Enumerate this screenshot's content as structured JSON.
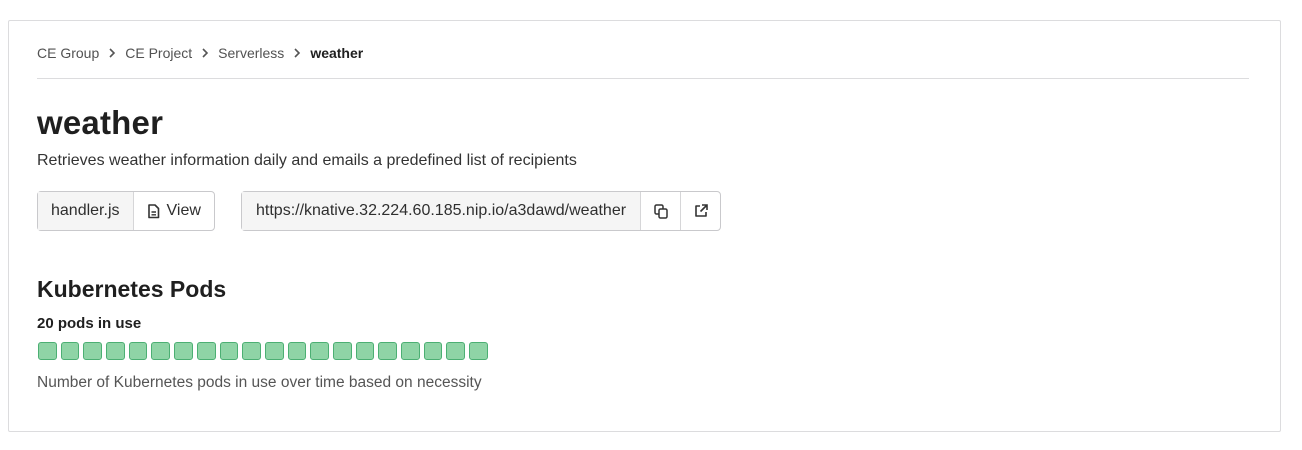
{
  "breadcrumb": {
    "items": [
      "CE Group",
      "CE Project",
      "Serverless"
    ],
    "current": "weather"
  },
  "function": {
    "title": "weather",
    "description": "Retrieves weather information daily and emails a predefined list of recipients",
    "handler_file": "handler.js",
    "view_label": "View",
    "url": "https://knative.32.224.60.185.nip.io/a3dawd/weather"
  },
  "icons": {
    "breadcrumb_separator": "chevron-right-icon",
    "view": "file-icon",
    "copy": "copy-icon",
    "open": "external-link-icon"
  },
  "pods": {
    "heading": "Kubernetes Pods",
    "count_label": "20 pods in use",
    "count": 20,
    "help_text": "Number of Kubernetes pods in use over time based on necessity",
    "pod_color": "#8fd4a6",
    "pod_border_color": "#4caf73"
  }
}
